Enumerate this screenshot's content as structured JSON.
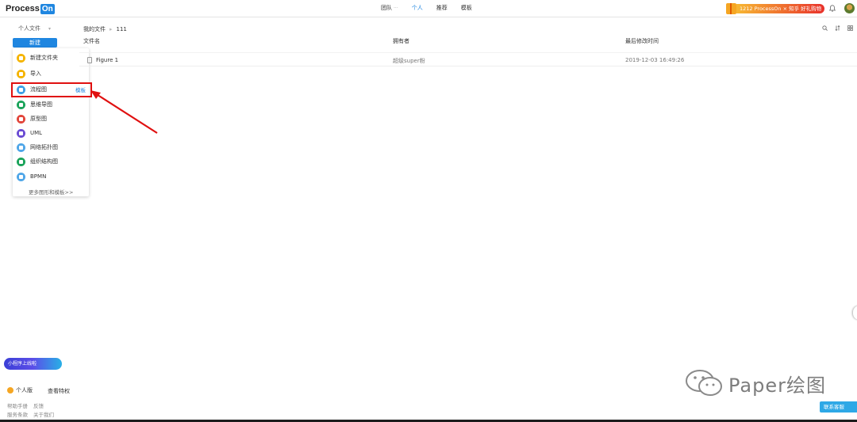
{
  "app": {
    "logo_main": "Process",
    "logo_on": "On"
  },
  "topnav": {
    "items": [
      "团队",
      "个人",
      "推荐",
      "模板"
    ],
    "team_sub": "···",
    "active": "个人"
  },
  "promo": {
    "text": "1212 ProcessOn × 知乎 好礼购物"
  },
  "sidebar": {
    "title": "个人文件",
    "new_button": "新建",
    "menu": [
      {
        "label": "新建文件夹",
        "color": "#f5b400"
      },
      {
        "label": "导入",
        "color": "#f5b400"
      },
      {
        "label": "流程图",
        "color": "#3fa0e6",
        "badge": "模板"
      },
      {
        "label": "思维导图",
        "color": "#1aa35a"
      },
      {
        "label": "原型图",
        "color": "#e2453a"
      },
      {
        "label": "UML",
        "color": "#6a4bd3"
      },
      {
        "label": "网络拓扑图",
        "color": "#4fa6e8"
      },
      {
        "label": "组织结构图",
        "color": "#1aa35a"
      },
      {
        "label": "BPMN",
        "color": "#4fa6e8"
      }
    ],
    "more": "更多图形和模板>>",
    "mini_program": "小程序上线啦",
    "version": "个人版",
    "privilege": "查看特权",
    "footer_links": [
      "帮助手册",
      "反馈",
      "服务条款",
      "关于我们"
    ]
  },
  "main": {
    "breadcrumb": [
      "我的文件",
      "111"
    ],
    "columns": [
      "文件名",
      "拥有者",
      "最后修改时间"
    ],
    "rows": [
      {
        "name": "Figure 1",
        "owner": "超级super粉",
        "modified": "2019-12-03 16:49:26"
      }
    ]
  },
  "watermark": "Paper绘图",
  "contact_button": "联系客服",
  "colors": {
    "accent": "#1f86e0",
    "highlight": "#e01010"
  }
}
